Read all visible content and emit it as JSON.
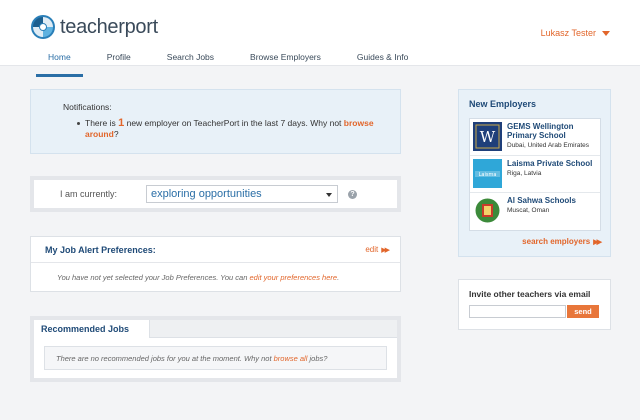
{
  "header": {
    "logo_text": "teacherport",
    "user_name": "Lukasz Tester",
    "nav": [
      "Home",
      "Profile",
      "Search Jobs",
      "Browse Employers",
      "Guides & Info"
    ],
    "active_nav": "Home"
  },
  "notifications": {
    "title": "Notifications:",
    "text_before": "There is",
    "count": "1",
    "text_after": "new employer on TeacherPort in the last 7 days. Why not",
    "link": "browse around",
    "end": "?"
  },
  "status": {
    "label": "I am currently:",
    "selected": "exploring opportunities",
    "help_glyph": "?"
  },
  "job_alert": {
    "title": "My Job Alert Preferences:",
    "edit_label": "edit",
    "body_text": "You have not yet selected your Job Preferences. You can",
    "body_link": "edit your preferences here",
    "body_end": "."
  },
  "recommended": {
    "tab_label": "Recommended Jobs",
    "text_before": "There are no recommended jobs for you at the moment. Why not",
    "link": "browse all",
    "text_after": "jobs?"
  },
  "new_employers": {
    "title": "New Employers",
    "items": [
      {
        "name": "GEMS Wellington Primary School",
        "location": "Dubai, United Arab Emirates",
        "logo": "crest-w"
      },
      {
        "name": "Laisma Private School",
        "location": "Riga, Latvia",
        "logo": "laisma"
      },
      {
        "name": "Al Sahwa Schools",
        "location": "Muscat, Oman",
        "logo": "green-crest"
      }
    ],
    "search_link": "search employers"
  },
  "invite": {
    "title": "Invite other teachers via email",
    "input_value": "",
    "send_label": "send"
  },
  "colors": {
    "accent": "#e2662b",
    "brand_blue": "#1f4a77",
    "panel_blue": "#e8f1f8"
  }
}
